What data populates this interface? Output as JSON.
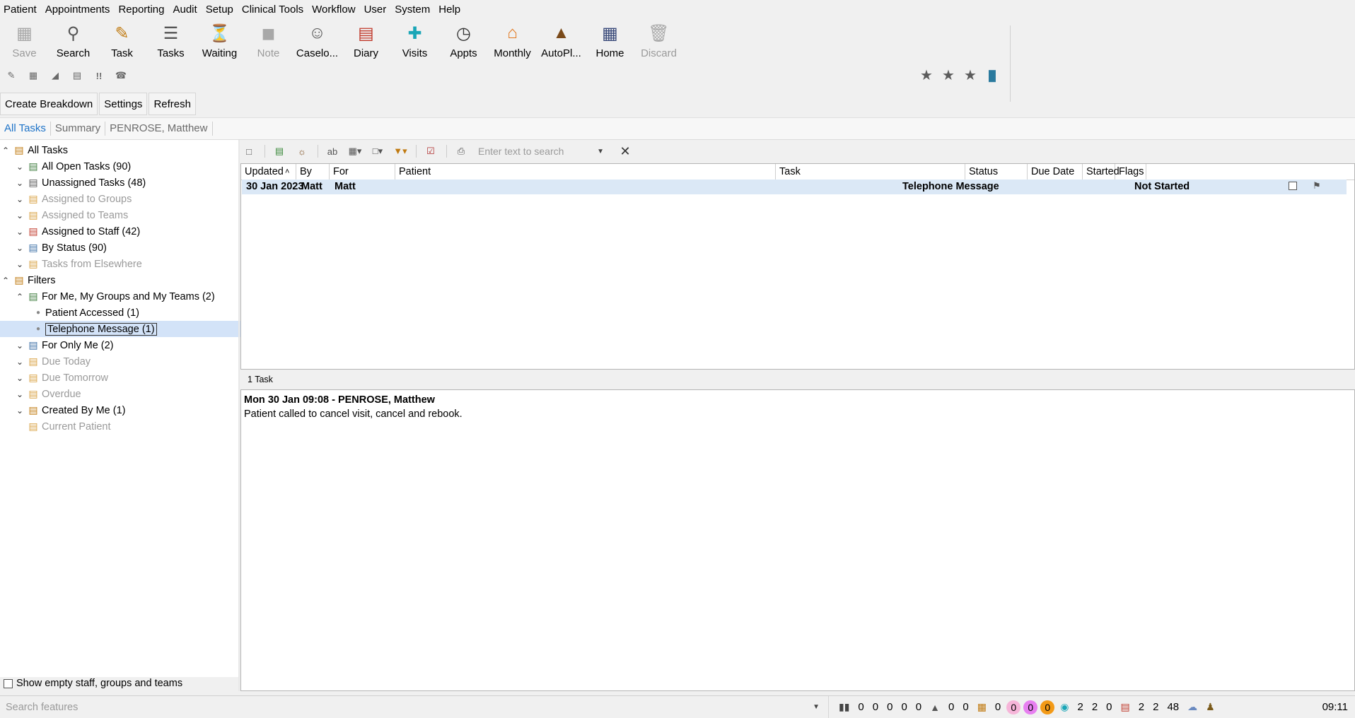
{
  "menu": [
    "Patient",
    "Appointments",
    "Reporting",
    "Audit",
    "Setup",
    "Clinical Tools",
    "Workflow",
    "User",
    "System",
    "Help"
  ],
  "toolbar": [
    {
      "label": "Save",
      "icon": "save-icon",
      "disabled": true
    },
    {
      "label": "Search",
      "icon": "search-icon",
      "disabled": false
    },
    {
      "label": "Task",
      "icon": "task-icon",
      "disabled": false
    },
    {
      "label": "Tasks",
      "icon": "tasks-icon",
      "disabled": false
    },
    {
      "label": "Waiting",
      "icon": "waiting-icon",
      "disabled": false
    },
    {
      "label": "Note",
      "icon": "note-icon",
      "disabled": true
    },
    {
      "label": "Caselo...",
      "icon": "caseload-icon",
      "disabled": false
    },
    {
      "label": "Diary",
      "icon": "diary-icon",
      "disabled": false
    },
    {
      "label": "Visits",
      "icon": "visits-icon",
      "disabled": false
    },
    {
      "label": "Appts",
      "icon": "appts-icon",
      "disabled": false
    },
    {
      "label": "Monthly",
      "icon": "monthly-icon",
      "disabled": false
    },
    {
      "label": "AutoPl...",
      "icon": "autoplanner-icon",
      "disabled": false
    },
    {
      "label": "Home",
      "icon": "home-icon",
      "disabled": false
    },
    {
      "label": "Discard",
      "icon": "trash-icon",
      "disabled": true
    }
  ],
  "actions": {
    "create_breakdown": "Create Breakdown",
    "settings": "Settings",
    "refresh": "Refresh"
  },
  "tabs": [
    {
      "label": "All Tasks",
      "active": true
    },
    {
      "label": "Summary",
      "active": false
    },
    {
      "label": "PENROSE, Matthew",
      "active": false
    }
  ],
  "tree": [
    {
      "label": "All Tasks",
      "chev": "^",
      "indent": 0,
      "grey": false
    },
    {
      "label": "All Open Tasks (90)",
      "chev": "v",
      "indent": 1,
      "grey": false
    },
    {
      "label": "Unassigned Tasks (48)",
      "chev": "v",
      "indent": 1,
      "grey": false
    },
    {
      "label": "Assigned to Groups",
      "chev": "v",
      "indent": 1,
      "grey": true
    },
    {
      "label": "Assigned to Teams",
      "chev": "v",
      "indent": 1,
      "grey": true
    },
    {
      "label": "Assigned to Staff (42)",
      "chev": "v",
      "indent": 1,
      "grey": false
    },
    {
      "label": "By Status (90)",
      "chev": "v",
      "indent": 1,
      "grey": false
    },
    {
      "label": "Tasks from Elsewhere",
      "chev": "v",
      "indent": 1,
      "grey": true
    },
    {
      "label": "Filters",
      "chev": "^",
      "indent": 0,
      "grey": false
    },
    {
      "label": "For Me, My Groups and My Teams (2)",
      "chev": "^",
      "indent": 1,
      "grey": false
    },
    {
      "label": "Patient Accessed (1)",
      "chev": "",
      "indent": 2,
      "grey": false
    },
    {
      "label": "Telephone Message (1)",
      "chev": "",
      "indent": 2,
      "grey": false,
      "selected": true
    },
    {
      "label": "For Only Me (2)",
      "chev": "v",
      "indent": 1,
      "grey": false
    },
    {
      "label": "Due Today",
      "chev": "v",
      "indent": 1,
      "grey": true
    },
    {
      "label": "Due Tomorrow",
      "chev": "v",
      "indent": 1,
      "grey": true
    },
    {
      "label": "Overdue",
      "chev": "v",
      "indent": 1,
      "grey": true
    },
    {
      "label": "Created By Me (1)",
      "chev": "v",
      "indent": 1,
      "grey": false
    },
    {
      "label": "Current Patient",
      "chev": "",
      "indent": 1,
      "grey": true
    }
  ],
  "show_empty_label": "Show empty staff, groups and teams",
  "search": {
    "placeholder": "Enter text to search"
  },
  "grid": {
    "columns": [
      "Updated",
      "By",
      "For",
      "Patient",
      "Task",
      "Status",
      "Due Date",
      "Started",
      "Flags"
    ],
    "row": {
      "updated": "30 Jan 2023",
      "by": "Matt",
      "for": "Matt",
      "patient": "",
      "task": "Telephone Message",
      "status": "Not Started",
      "due": ""
    }
  },
  "task_count": "1 Task",
  "detail": {
    "title": "Mon 30 Jan 09:08 - PENROSE, Matthew",
    "body": "Patient called to cancel visit, cancel and rebook."
  },
  "status_bar": {
    "feature_search_placeholder": "Search features",
    "group1": [
      "0",
      "0",
      "0",
      "0",
      "0"
    ],
    "group2": [
      "0",
      "0"
    ],
    "group3": [
      "0"
    ],
    "pills": [
      {
        "v": "0",
        "color": "#f6b5d9"
      },
      {
        "v": "0",
        "color": "#e77ff0"
      },
      {
        "v": "0",
        "color": "#f39a17"
      }
    ],
    "group4": [
      "2",
      "2",
      "0"
    ],
    "group5": [
      "2",
      "2",
      "48"
    ],
    "clock": "09:11"
  }
}
